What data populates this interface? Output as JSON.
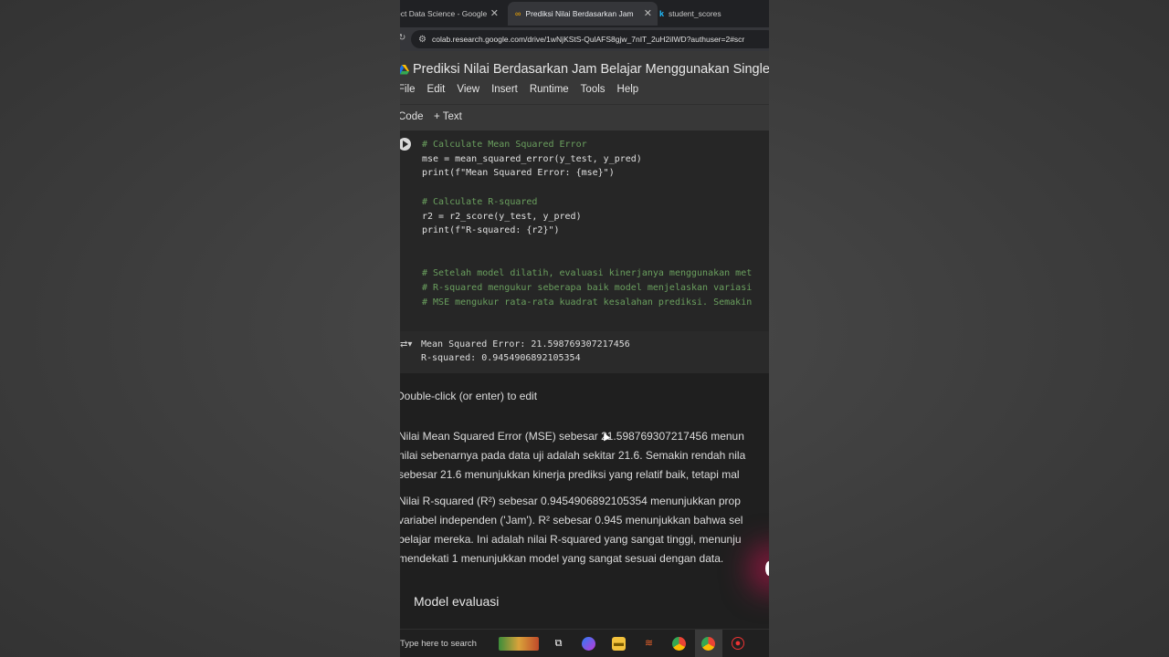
{
  "browser": {
    "tabs": [
      {
        "label": "ect Data Science - Google",
        "active": false
      },
      {
        "label": "Prediksi Nilai Berdasarkan Jam",
        "active": true
      },
      {
        "label": "student_scores",
        "active": false
      }
    ],
    "url": "colab.research.google.com/drive/1wNjKStS-QulAFS8gjw_7nIT_2uH2iIWD?authuser=2#scr"
  },
  "notebook": {
    "title": "Prediksi Nilai Berdasarkan Jam Belajar Menggunakan Single",
    "menu": [
      "File",
      "Edit",
      "View",
      "Insert",
      "Runtime",
      "Tools",
      "Help"
    ],
    "toolbar": {
      "code_label": "Code",
      "text_label": "+ Text"
    }
  },
  "cell": {
    "lines": [
      "# Calculate Mean Squared Error",
      "mse = mean_squared_error(y_test, y_pred)",
      "print(f\"Mean Squared Error: {mse}\")",
      "",
      "# Calculate R-squared",
      "r2 = r2_score(y_test, y_pred)",
      "print(f\"R-squared: {r2}\")",
      "",
      "",
      "# Setelah model dilatih, evaluasi kinerjanya menggunakan met",
      "# R-squared mengukur seberapa baik model menjelaskan variasi",
      "# MSE mengukur rata-rata kuadrat kesalahan prediksi. Semakin"
    ]
  },
  "output": {
    "lines": [
      "Mean Squared Error: 21.598769307217456",
      "R-squared: 0.9454906892105354"
    ]
  },
  "text_cell": {
    "hint": "Double-click (or enter) to edit",
    "para1": [
      "Nilai Mean Squared Error (MSE) sebesar 21.598769307217456 menun",
      "nilai sebenarnya pada data uji adalah sekitar 21.6. Semakin rendah nila",
      "sebesar 21.6 menunjukkan kinerja prediksi yang relatif baik, tetapi mal"
    ],
    "para2": [
      "Nilai R-squared (R²) sebesar 0.9454906892105354 menunjukkan prop",
      "variabel independen ('Jam'). R² sebesar 0.945 menunjukkan bahwa sel",
      "belajar mereka. Ini adalah nilai R-squared yang sangat tinggi, menunju",
      "mendekati 1 menunjukkan model yang sangat sesuai dengan data."
    ],
    "section_heading": "Model evaluasi"
  },
  "taskbar": {
    "search_placeholder": "Type here to search"
  }
}
